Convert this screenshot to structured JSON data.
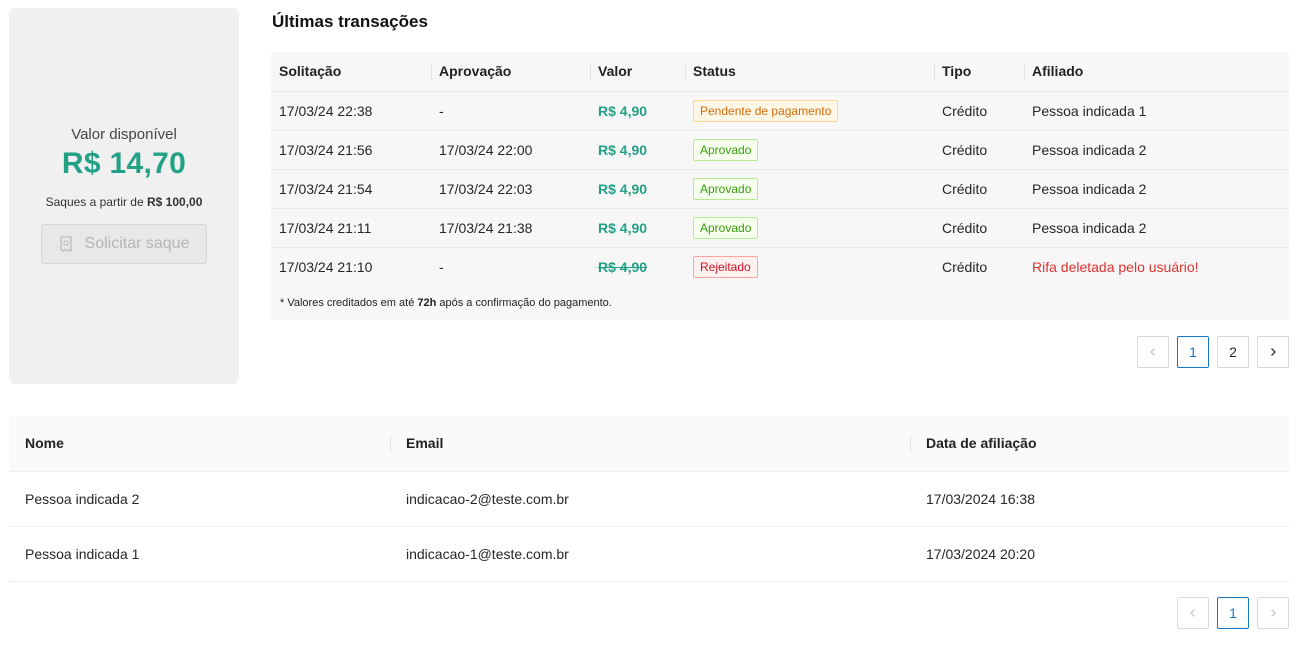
{
  "balance": {
    "label": "Valor disponível",
    "value": "R$ 14,70",
    "note_prefix": "Saques a partir de ",
    "note_amount": "R$ 100,00",
    "withdraw_label": "Solicitar saque",
    "withdraw_icon": "receipt-icon"
  },
  "transactions": {
    "title": "Últimas transações",
    "columns": [
      "Solitação",
      "Aprovação",
      "Valor",
      "Status",
      "Tipo",
      "Afiliado"
    ],
    "rows": [
      {
        "requested": "17/03/24 22:38",
        "approved": "-",
        "value": "R$ 4,90",
        "status": "Pendente de pagamento",
        "type": "Crédito",
        "affiliate": "Pessoa indicada 1"
      },
      {
        "requested": "17/03/24 21:56",
        "approved": "17/03/24 22:00",
        "value": "R$ 4,90",
        "status": "Aprovado",
        "type": "Crédito",
        "affiliate": "Pessoa indicada 2"
      },
      {
        "requested": "17/03/24 21:54",
        "approved": "17/03/24 22:03",
        "value": "R$ 4,90",
        "status": "Aprovado",
        "type": "Crédito",
        "affiliate": "Pessoa indicada 2"
      },
      {
        "requested": "17/03/24 21:11",
        "approved": "17/03/24 21:38",
        "value": "R$ 4,90",
        "status": "Aprovado",
        "type": "Crédito",
        "affiliate": "Pessoa indicada 2"
      },
      {
        "requested": "17/03/24 21:10",
        "approved": "-",
        "value": "R$ 4,90",
        "status": "Rejeitado",
        "type": "Crédito",
        "affiliate": "Rifa deletada pelo usuário!"
      }
    ],
    "footnote_prefix": "* Valores creditados em até ",
    "footnote_bold": "72h",
    "footnote_suffix": " após a confirmação do pagamento.",
    "pagination": {
      "pages": [
        "1",
        "2"
      ],
      "current": "1"
    }
  },
  "referrals": {
    "columns": [
      "Nome",
      "Email",
      "Data de afiliação"
    ],
    "rows": [
      {
        "name": "Pessoa indicada 2",
        "email": "indicacao-2@teste.com.br",
        "date": "17/03/2024 16:38"
      },
      {
        "name": "Pessoa indicada 1",
        "email": "indicacao-1@teste.com.br",
        "date": "17/03/2024 20:20"
      }
    ],
    "pagination": {
      "pages": [
        "1"
      ],
      "current": "1"
    }
  },
  "colors": {
    "accent_green": "#23a186",
    "danger_red": "#e0332f",
    "pager_active": "#1677c9"
  }
}
